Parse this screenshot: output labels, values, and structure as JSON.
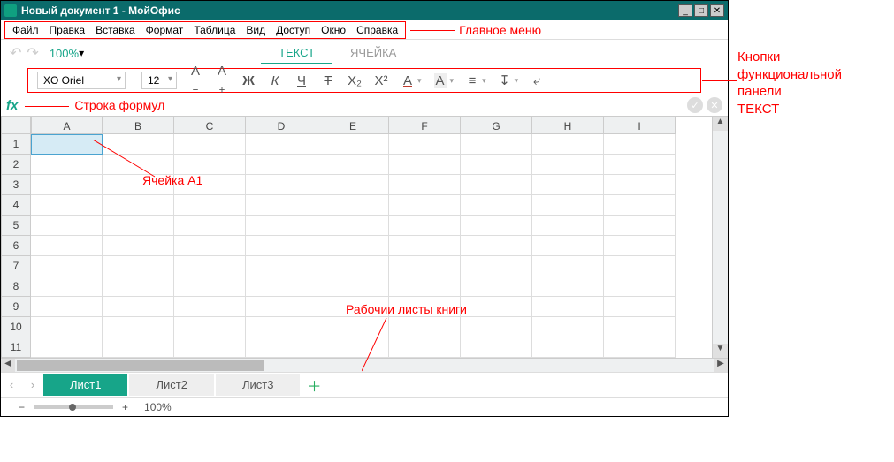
{
  "titlebar": {
    "title": "Новый документ 1 - МойОфис"
  },
  "menu": {
    "items": [
      "Файл",
      "Правка",
      "Вставка",
      "Формат",
      "Таблица",
      "Вид",
      "Доступ",
      "Окно",
      "Справка"
    ],
    "annotation": "Главное меню"
  },
  "quick": {
    "zoom": "100%",
    "tab_text": "ТЕКСТ",
    "tab_cell": "ЯЧЕЙКА"
  },
  "toolbar": {
    "font": "XO Oriel",
    "size": "12"
  },
  "formula": {
    "fx": "fx",
    "annotation": "Строка формул"
  },
  "grid": {
    "columns": [
      "A",
      "B",
      "C",
      "D",
      "E",
      "F",
      "G",
      "H",
      "I"
    ],
    "rows": [
      "1",
      "2",
      "3",
      "4",
      "5",
      "6",
      "7",
      "8",
      "9",
      "10",
      "11"
    ],
    "cell_annotation": "Ячейка А1",
    "selected": "A1"
  },
  "sheets": {
    "tabs": [
      "Лист1",
      "Лист2",
      "Лист3"
    ],
    "active": 0,
    "annotation": "Рабочии листы книги"
  },
  "status": {
    "zoom": "100%"
  },
  "side_annotation": {
    "l1": "Кнопки",
    "l2": "функциональной",
    "l3": "панели",
    "l4": "ТЕКСТ"
  }
}
